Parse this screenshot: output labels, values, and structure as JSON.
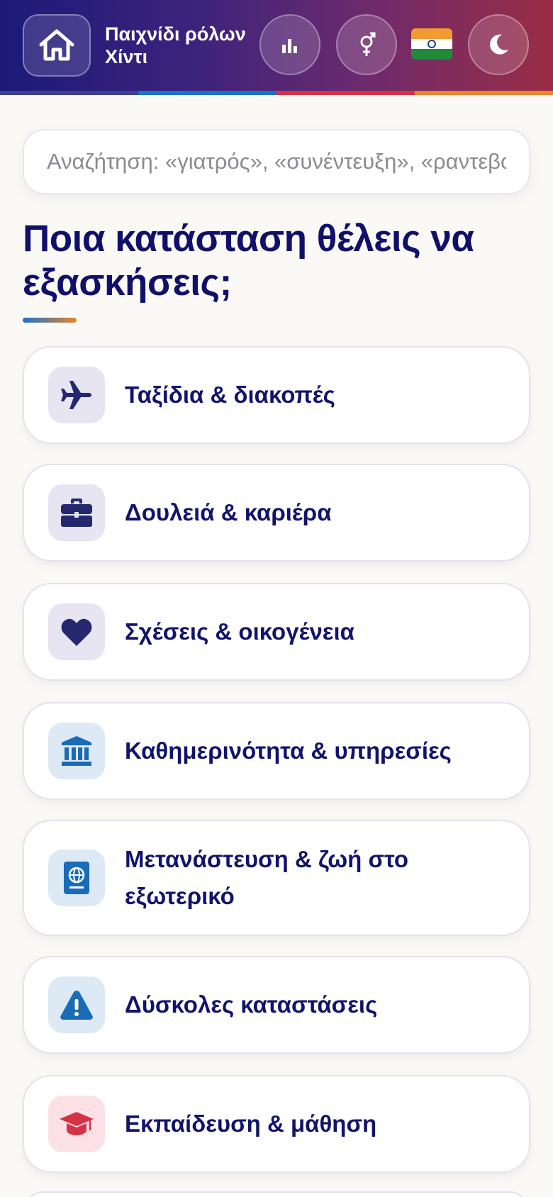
{
  "header": {
    "title": "Παιχνίδι ρόλων Χίντι",
    "icons": [
      "home-icon",
      "stats-icon",
      "gender-icon",
      "india-flag-icon",
      "moon-icon"
    ]
  },
  "search": {
    "placeholder": "Αναζήτηση: «γιατρός», «συνέντευξη», «ραντεβού»"
  },
  "main": {
    "heading": "Ποια κατάσταση θέλεις να εξασκήσεις;",
    "categories": [
      {
        "label": "Ταξίδια & διακοπές",
        "icon": "airplane-icon",
        "tint": "#e6e5f1"
      },
      {
        "label": "Δουλειά & καριέρα",
        "icon": "briefcase-icon",
        "tint": "#e6e5f1"
      },
      {
        "label": "Σχέσεις & οικογένεια",
        "icon": "heart-icon",
        "tint": "#e6e5f1"
      },
      {
        "label": "Καθημερινότητα & υπηρεσίες",
        "icon": "bank-icon",
        "tint": "#dde9f5"
      },
      {
        "label": "Μετανάστευση & ζωή στο εξωτερικό",
        "icon": "passport-icon",
        "tint": "#dde9f5"
      },
      {
        "label": "Δύσκολες καταστάσεις",
        "icon": "warning-icon",
        "tint": "#dde9f5"
      },
      {
        "label": "Εκπαίδευση & μάθηση",
        "icon": "graduation-cap-icon",
        "tint": "#fbe1e5"
      }
    ]
  },
  "colors": {
    "accent_navy": "#12136b",
    "accent_blue": "#1a6bb8",
    "accent_red": "#d43346",
    "accent_orange": "#e8852e"
  }
}
